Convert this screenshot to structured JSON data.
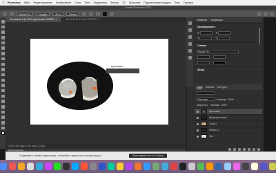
{
  "menubar": {
    "app": "Photoshop",
    "items": [
      "Файл",
      "Редактирование",
      "Изображение",
      "Слои",
      "Текст",
      "Выделение",
      "Фильтр",
      "3D",
      "Просмотр",
      "Подключаемые модули",
      "Окно",
      "Справка"
    ]
  },
  "title": "Adobe Photoshop 2022",
  "options": {
    "font": "Myriad Pro",
    "style": "Regular",
    "size": "30 пт",
    "aa": "Резкое"
  },
  "tabs": [
    {
      "label": "Без имени-1 @ 100% (кроссовки, RGB/8*) ×",
      "active": true
    },
    {
      "label": "Без 1 @ 33,3% (Кто, RGB/8*) ×",
      "active": false
    }
  ],
  "canvas": {
    "caption": "кроссовки"
  },
  "status": {
    "zoom_info": "100%  1000 пикс. х 591 пикс. (72 ppi)",
    "timeline": "Шкала времени"
  },
  "properties": {
    "tabs": [
      "Свойства",
      "Коррекция"
    ],
    "section1": "Преобразовать",
    "section2": "Символ",
    "section3": "Абзац",
    "field_labels": [
      "Ш",
      "В",
      "X",
      "Y"
    ],
    "font_row": "Myriad Pro"
  },
  "layers": {
    "tabs": [
      "Слои",
      "Каналы",
      "Контуры"
    ],
    "blend": "Обычные",
    "opacity_label": "Непрозр.: 100%",
    "fill_label": "Заливка: 100%",
    "lock_label": "Закрепить:",
    "items": [
      {
        "name": "кроссовки",
        "kind": "text",
        "selected": true
      },
      {
        "name": "Прямоугольник 1",
        "kind": "shape",
        "selected": false
      },
      {
        "name": "Слой 2",
        "kind": "image",
        "selected": false
      },
      {
        "name": "Эллипс 1",
        "kind": "dark",
        "selected": false
      },
      {
        "name": "Фон",
        "kind": "white",
        "selected": false
      }
    ]
  },
  "webstrip": {
    "left": "Создавайте онлайн-видеоуроки, собирайте студентов по всему миру и",
    "right": "Присоединиться на Udemy"
  },
  "dock_colors": [
    "#4f8cf7",
    "#e55",
    "#f5a623",
    "#ddd",
    "#3ad",
    "#c4f",
    "#2d2",
    "#333",
    "#0af",
    "#f53",
    "#888",
    "#35c",
    "#0c9",
    "#fc3",
    "#a4e",
    "#e73",
    "#39f",
    "#7a7",
    "#4ad",
    "#d44",
    "#222",
    "#ccc",
    "#5b5",
    "#f90",
    "#36a",
    "#9cf",
    "#e6e",
    "#444",
    "#ffd",
    "#55c",
    "#cc5"
  ]
}
